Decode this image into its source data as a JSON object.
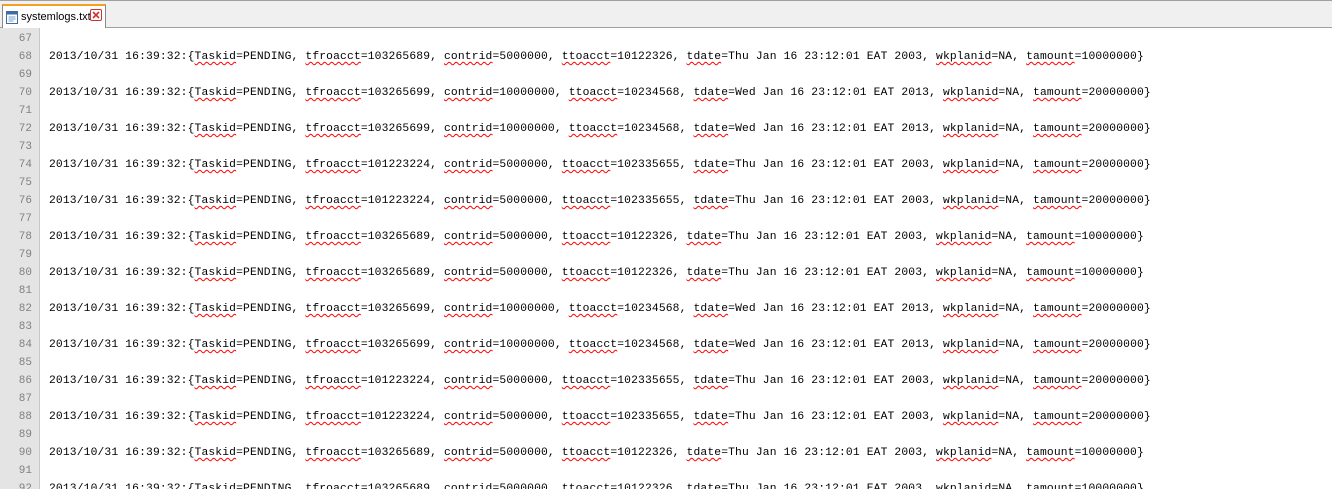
{
  "tab": {
    "filename": "systemlogs.txt"
  },
  "icons": {
    "file": "notepad-file-icon",
    "close": "close-tab-icon"
  },
  "colors": {
    "gutter_bg": "#e4e4e4",
    "line_number": "#808080",
    "spellcheck_squiggle": "#ff0000",
    "tab_accent": "#f5a020"
  },
  "editor": {
    "lines": [
      {
        "number": "67",
        "text": ""
      },
      {
        "number": "68",
        "text": "2013/10/31 16:39:32:{Taskid=PENDING, tfroacct=103265689, contrid=5000000, ttoacct=10122326, tdate=Thu Jan 16 23:12:01 EAT 2003, wkplanid=NA, tamount=10000000}"
      },
      {
        "number": "69",
        "text": ""
      },
      {
        "number": "70",
        "text": "2013/10/31 16:39:32:{Taskid=PENDING, tfroacct=103265699, contrid=10000000, ttoacct=10234568, tdate=Wed Jan 16 23:12:01 EAT 2013, wkplanid=NA, tamount=20000000}"
      },
      {
        "number": "71",
        "text": ""
      },
      {
        "number": "72",
        "text": "2013/10/31 16:39:32:{Taskid=PENDING, tfroacct=103265699, contrid=10000000, ttoacct=10234568, tdate=Wed Jan 16 23:12:01 EAT 2013, wkplanid=NA, tamount=20000000}"
      },
      {
        "number": "73",
        "text": ""
      },
      {
        "number": "74",
        "text": "2013/10/31 16:39:32:{Taskid=PENDING, tfroacct=101223224, contrid=5000000, ttoacct=102335655, tdate=Thu Jan 16 23:12:01 EAT 2003, wkplanid=NA, tamount=20000000}"
      },
      {
        "number": "75",
        "text": ""
      },
      {
        "number": "76",
        "text": "2013/10/31 16:39:32:{Taskid=PENDING, tfroacct=101223224, contrid=5000000, ttoacct=102335655, tdate=Thu Jan 16 23:12:01 EAT 2003, wkplanid=NA, tamount=20000000}"
      },
      {
        "number": "77",
        "text": ""
      },
      {
        "number": "78",
        "text": "2013/10/31 16:39:32:{Taskid=PENDING, tfroacct=103265689, contrid=5000000, ttoacct=10122326, tdate=Thu Jan 16 23:12:01 EAT 2003, wkplanid=NA, tamount=10000000}"
      },
      {
        "number": "79",
        "text": ""
      },
      {
        "number": "80",
        "text": "2013/10/31 16:39:32:{Taskid=PENDING, tfroacct=103265689, contrid=5000000, ttoacct=10122326, tdate=Thu Jan 16 23:12:01 EAT 2003, wkplanid=NA, tamount=10000000}"
      },
      {
        "number": "81",
        "text": ""
      },
      {
        "number": "82",
        "text": "2013/10/31 16:39:32:{Taskid=PENDING, tfroacct=103265699, contrid=10000000, ttoacct=10234568, tdate=Wed Jan 16 23:12:01 EAT 2013, wkplanid=NA, tamount=20000000}"
      },
      {
        "number": "83",
        "text": ""
      },
      {
        "number": "84",
        "text": "2013/10/31 16:39:32:{Taskid=PENDING, tfroacct=103265699, contrid=10000000, ttoacct=10234568, tdate=Wed Jan 16 23:12:01 EAT 2013, wkplanid=NA, tamount=20000000}"
      },
      {
        "number": "85",
        "text": ""
      },
      {
        "number": "86",
        "text": "2013/10/31 16:39:32:{Taskid=PENDING, tfroacct=101223224, contrid=5000000, ttoacct=102335655, tdate=Thu Jan 16 23:12:01 EAT 2003, wkplanid=NA, tamount=20000000}"
      },
      {
        "number": "87",
        "text": ""
      },
      {
        "number": "88",
        "text": "2013/10/31 16:39:32:{Taskid=PENDING, tfroacct=101223224, contrid=5000000, ttoacct=102335655, tdate=Thu Jan 16 23:12:01 EAT 2003, wkplanid=NA, tamount=20000000}"
      },
      {
        "number": "89",
        "text": ""
      },
      {
        "number": "90",
        "text": "2013/10/31 16:39:32:{Taskid=PENDING, tfroacct=103265689, contrid=5000000, ttoacct=10122326, tdate=Thu Jan 16 23:12:01 EAT 2003, wkplanid=NA, tamount=10000000}"
      },
      {
        "number": "91",
        "text": ""
      },
      {
        "number": "92",
        "text": "2013/10/31 16:39:32:{Taskid=PENDING, tfroacct=103265689, contrid=5000000, ttoacct=10122326, tdate=Thu Jan 16 23:12:01 EAT 2003, wkplanid=NA, tamount=10000000}"
      }
    ],
    "spellcheck_words": [
      "Taskid",
      "tfroacct",
      "contrid",
      "ttoacct",
      "tdate",
      "wkplanid",
      "tamount"
    ]
  }
}
